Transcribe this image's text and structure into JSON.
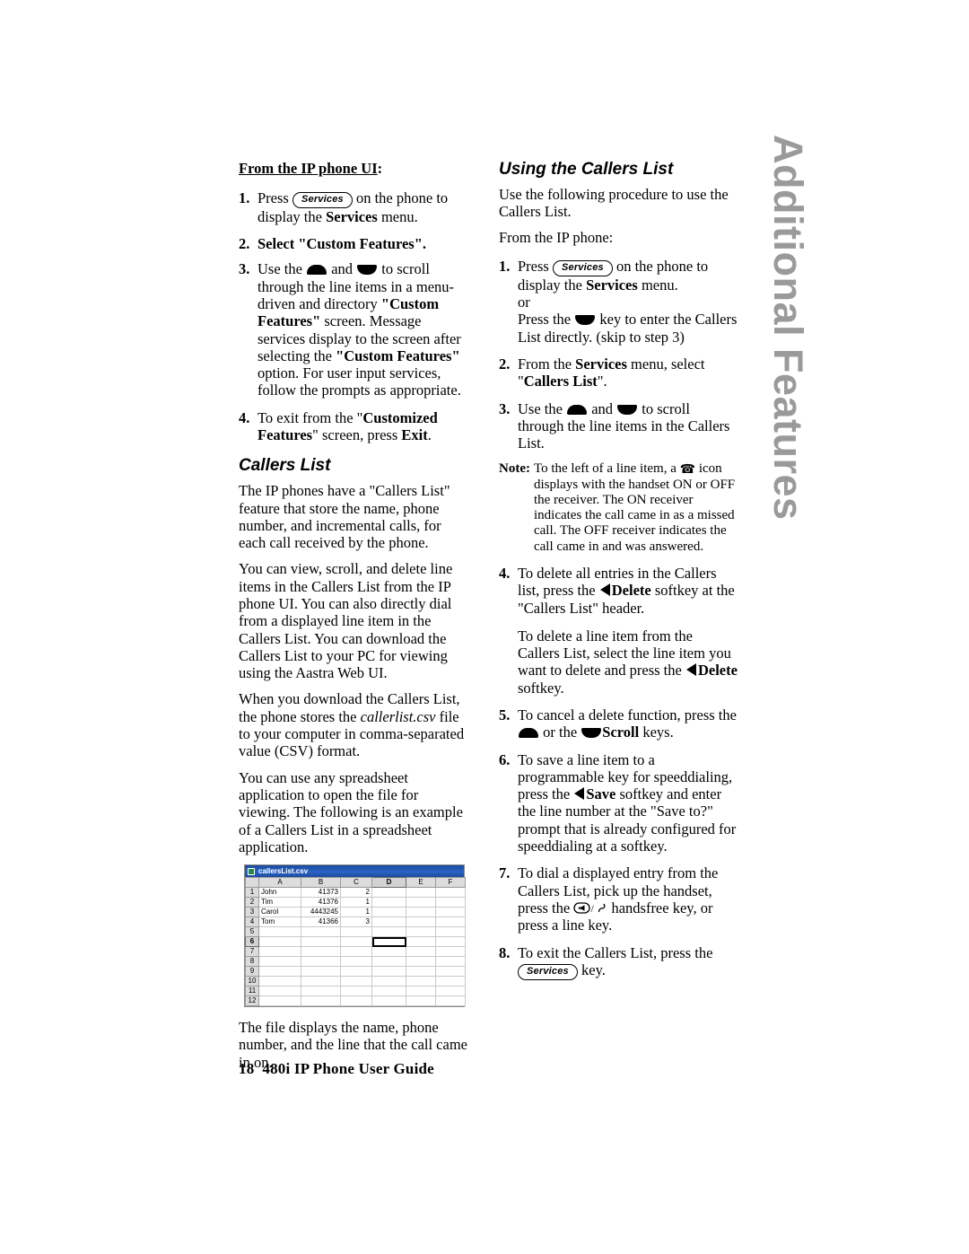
{
  "side_tab": {
    "label": "Additional Features",
    "color": "#9a9a9a"
  },
  "footer": {
    "page_number": "18",
    "guide_title": "480i IP Phone User Guide"
  },
  "left_column": {
    "heading": {
      "underlined": "From the IP phone UI",
      "trailing": ":"
    },
    "steps": [
      {
        "num": "1.",
        "pre": "Press",
        "key": "Services",
        "post_a": "on the phone to display the",
        "bold": "Services",
        "post_b": "menu."
      },
      {
        "num": "2.",
        "text": "Select \"Custom Features\"."
      },
      {
        "num": "3.",
        "t1": "Use the",
        "t2": "and",
        "t3": "to scroll through the line items in a menu-driven and directory",
        "b1": "\"Custom Features\"",
        "t4": "screen. Message services display to the screen after selecting the",
        "b2": "\"Custom Features\"",
        "t5": "option. For user input services, follow the prompts as appropriate."
      },
      {
        "num": "4.",
        "t1": "To exit from the \"",
        "b1": "Customized Features",
        "t2": "\" screen, press",
        "b2": "Exit",
        "t3": "."
      }
    ],
    "callers_list_heading": "Callers List",
    "paragraphs": [
      "The IP phones have a \"Callers List\" feature that store the name, phone number, and incremental calls, for each call received by the phone.",
      "You can view, scroll, and delete line items in the Callers List from the IP phone UI. You can also directly dial from a displayed line item in the Callers List. You can download the Callers List to your PC for viewing using the Aastra Web UI."
    ],
    "download_para": {
      "t1": "When you download the Callers List, the phone stores the",
      "file": "callerlist.csv",
      "t2": "file to your computer in comma-separated value (CSV) format."
    },
    "spreadsheet_para": "You can use any spreadsheet application to open the file for viewing. The following is an example of a Callers List in a spreadsheet application.",
    "closing_para": "The file displays the name, phone number, and the line that the call came in on."
  },
  "spreadsheet": {
    "window_title": "callersList.csv",
    "app_icon": "excel-document-icon",
    "columns": [
      "A",
      "B",
      "C",
      "D",
      "E",
      "F"
    ],
    "active_column": "D",
    "rows": [
      "1",
      "2",
      "3",
      "4",
      "5",
      "6",
      "7",
      "8",
      "9",
      "10",
      "11",
      "12"
    ],
    "active_row": "6",
    "selected_cell": "D6",
    "data": [
      {
        "row": "1",
        "A": "John",
        "B": "41373",
        "C": "2"
      },
      {
        "row": "2",
        "A": "Tim",
        "B": "41376",
        "C": "1"
      },
      {
        "row": "3",
        "A": "Carol",
        "B": "4443245",
        "C": "1"
      },
      {
        "row": "4",
        "A": "Tom",
        "B": "41366",
        "C": "3"
      }
    ]
  },
  "right_column": {
    "heading": "Using the Callers List",
    "intro_1": "Use the following procedure to use the Callers List.",
    "intro_2": "From the IP phone:",
    "steps": [
      {
        "num": "1.",
        "t1": "Press",
        "key": "Services",
        "t2": "on the phone to display the",
        "b1": "Services",
        "t3": "menu.",
        "or": "or",
        "t4": "Press the",
        "t5": "key to enter the Callers List directly. (skip to step 3)"
      },
      {
        "num": "2.",
        "t1": "From the",
        "b1": "Services",
        "t2": "menu, select \"",
        "b2": "Callers List",
        "t3": "\"."
      },
      {
        "num": "3.",
        "t1": "Use the",
        "t2": "and",
        "t3": "to scroll through the line items in the Callers List."
      }
    ],
    "note": {
      "label": "Note:",
      "t1": "To the left of a line item, a",
      "icon": "telephone-handset-icon",
      "t2": "icon displays with the handset ON or OFF the receiver. The ON receiver indicates the call came in as a missed call. The OFF receiver indicates the call came in and was answered."
    },
    "steps_cont": [
      {
        "num": "4.",
        "t1": "To delete all entries in the Callers list, press the",
        "b1": "Delete",
        "t2": "softkey at the \"Callers List\" header.",
        "sub_t1": "To delete a line item from the Callers List, select the line item you want to delete and press the",
        "sub_b1": "Delete",
        "sub_t2": "softkey."
      },
      {
        "num": "5.",
        "t1": "To cancel a delete function, press the",
        "t2": "or the",
        "b1": "Scroll",
        "t3": "keys."
      },
      {
        "num": "6.",
        "t1": "To save a line item to a programmable key for speeddialing, press the",
        "b1": "Save",
        "t2": "softkey and enter the line number at the \"Save to?\" prompt that is already configured for speeddialing at a softkey."
      },
      {
        "num": "7.",
        "t1": "To dial a displayed entry from the Callers List, pick up the handset, press the",
        "t2": "handsfree key, or press a line key."
      },
      {
        "num": "8.",
        "t1": "To exit the Callers List, press the",
        "key": "Services",
        "t2": "key."
      }
    ]
  }
}
